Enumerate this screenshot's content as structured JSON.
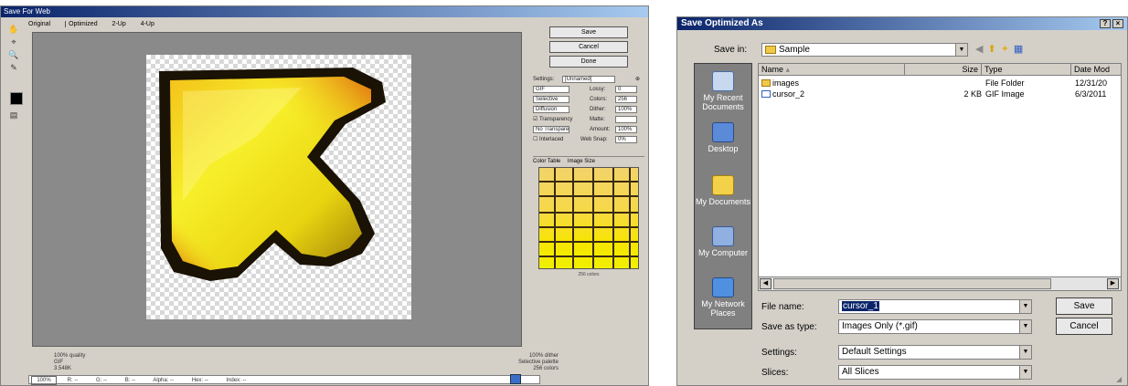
{
  "save_for_web": {
    "title": "Save For Web",
    "tabs": [
      "Original",
      "Optimized",
      "2-Up",
      "4-Up"
    ],
    "tools": [
      "hand-icon",
      "slice-select-icon",
      "zoom-icon",
      "eyedropper-icon"
    ],
    "buttons": {
      "save": "Save",
      "cancel": "Cancel",
      "done": "Done"
    },
    "settings": {
      "settings_label": "Settings:",
      "settings_value": "[Unnamed]",
      "format": "GIF",
      "reduction": "Selective",
      "dither_algo": "Diffusion",
      "transparency": "Transparency",
      "no_transparency_dither": "No Transparency Dither",
      "interlaced": "Interlaced",
      "colors_label": "Colors:",
      "colors_value": "256",
      "dither_label": "Dither:",
      "dither_value": "100%",
      "matte_label": "Matte:",
      "amount_label": "Amount:",
      "amount_value": "100%",
      "websnap_label": "Web Snap:",
      "websnap_value": "0%",
      "lossy_label": "Lossy:",
      "lossy_value": "0"
    },
    "color_table_label": "Color Table",
    "image_size_label": "Image Size",
    "color_count": "256 colors",
    "status_left": [
      "100% quality",
      "GIF",
      "3.548K"
    ],
    "status_right": [
      "100% dither",
      "Selective palette",
      "256 colors"
    ],
    "zoom": "100%",
    "bottom_bar": [
      "R: --",
      "G: --",
      "B: --",
      "Alpha: --",
      "Hex: --",
      "Index: --"
    ]
  },
  "save_dialog": {
    "title": "Save Optimized As",
    "help_btn": "?",
    "close_btn": "×",
    "save_in_label": "Save in:",
    "save_in_value": "Sample",
    "places": [
      "My Recent Documents",
      "Desktop",
      "My Documents",
      "My Computer",
      "My Network Places"
    ],
    "columns": [
      "Name",
      "Size",
      "Type",
      "Date Mod"
    ],
    "files": [
      {
        "name": "images",
        "size": "",
        "type": "File Folder",
        "date": "12/31/20"
      },
      {
        "name": "cursor_2",
        "size": "2 KB",
        "type": "GIF Image",
        "date": "6/3/2011"
      }
    ],
    "file_name_label": "File name:",
    "file_name_value": "cursor_1",
    "save_as_type_label": "Save as type:",
    "save_as_type_value": "Images Only (*.gif)",
    "settings_label": "Settings:",
    "settings_value": "Default Settings",
    "slices_label": "Slices:",
    "slices_value": "All Slices",
    "save_button": "Save",
    "cancel_button": "Cancel"
  }
}
